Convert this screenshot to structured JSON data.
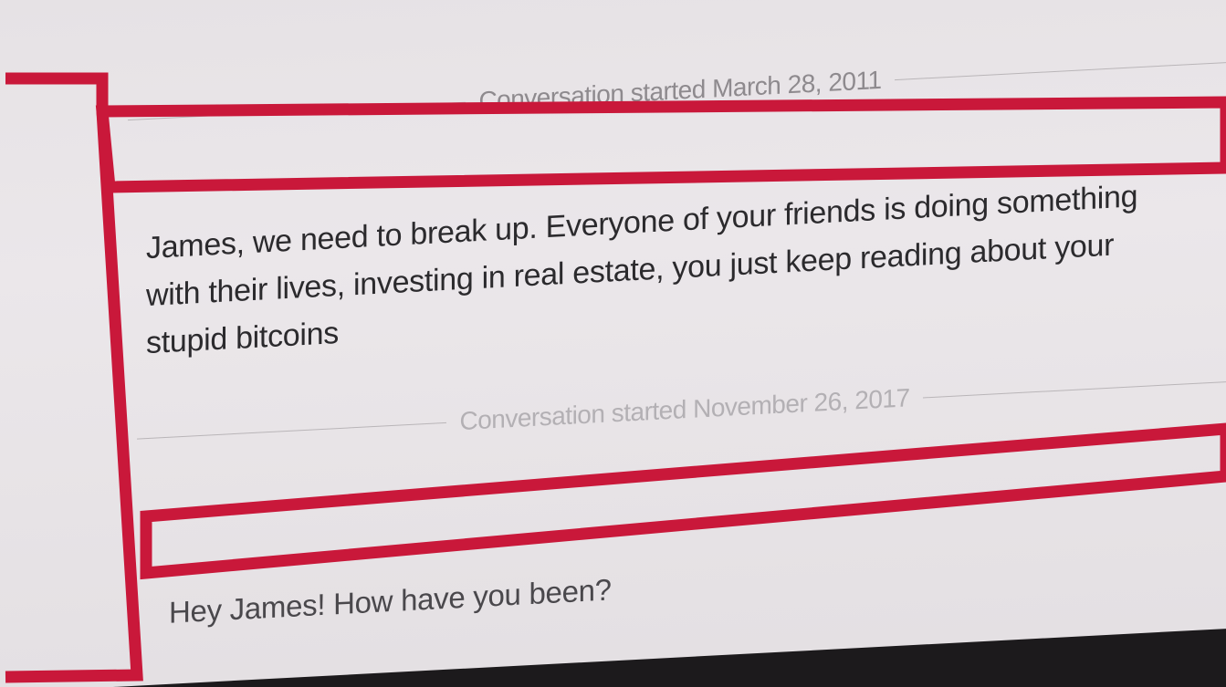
{
  "conversation": {
    "sessions": [
      {
        "divider_label": "Conversation started March 28, 2011",
        "message": "James, we need to break up. Everyone of your friends is doing something with their lives, investing in real estate, you just keep reading about your stupid bitcoins"
      },
      {
        "divider_label": "Conversation started November 26, 2017",
        "message": "Hey James! How have you been?"
      }
    ]
  },
  "colors": {
    "redaction": "#c9183a",
    "background": "#e8e4e7",
    "text": "#2b2a2d"
  }
}
